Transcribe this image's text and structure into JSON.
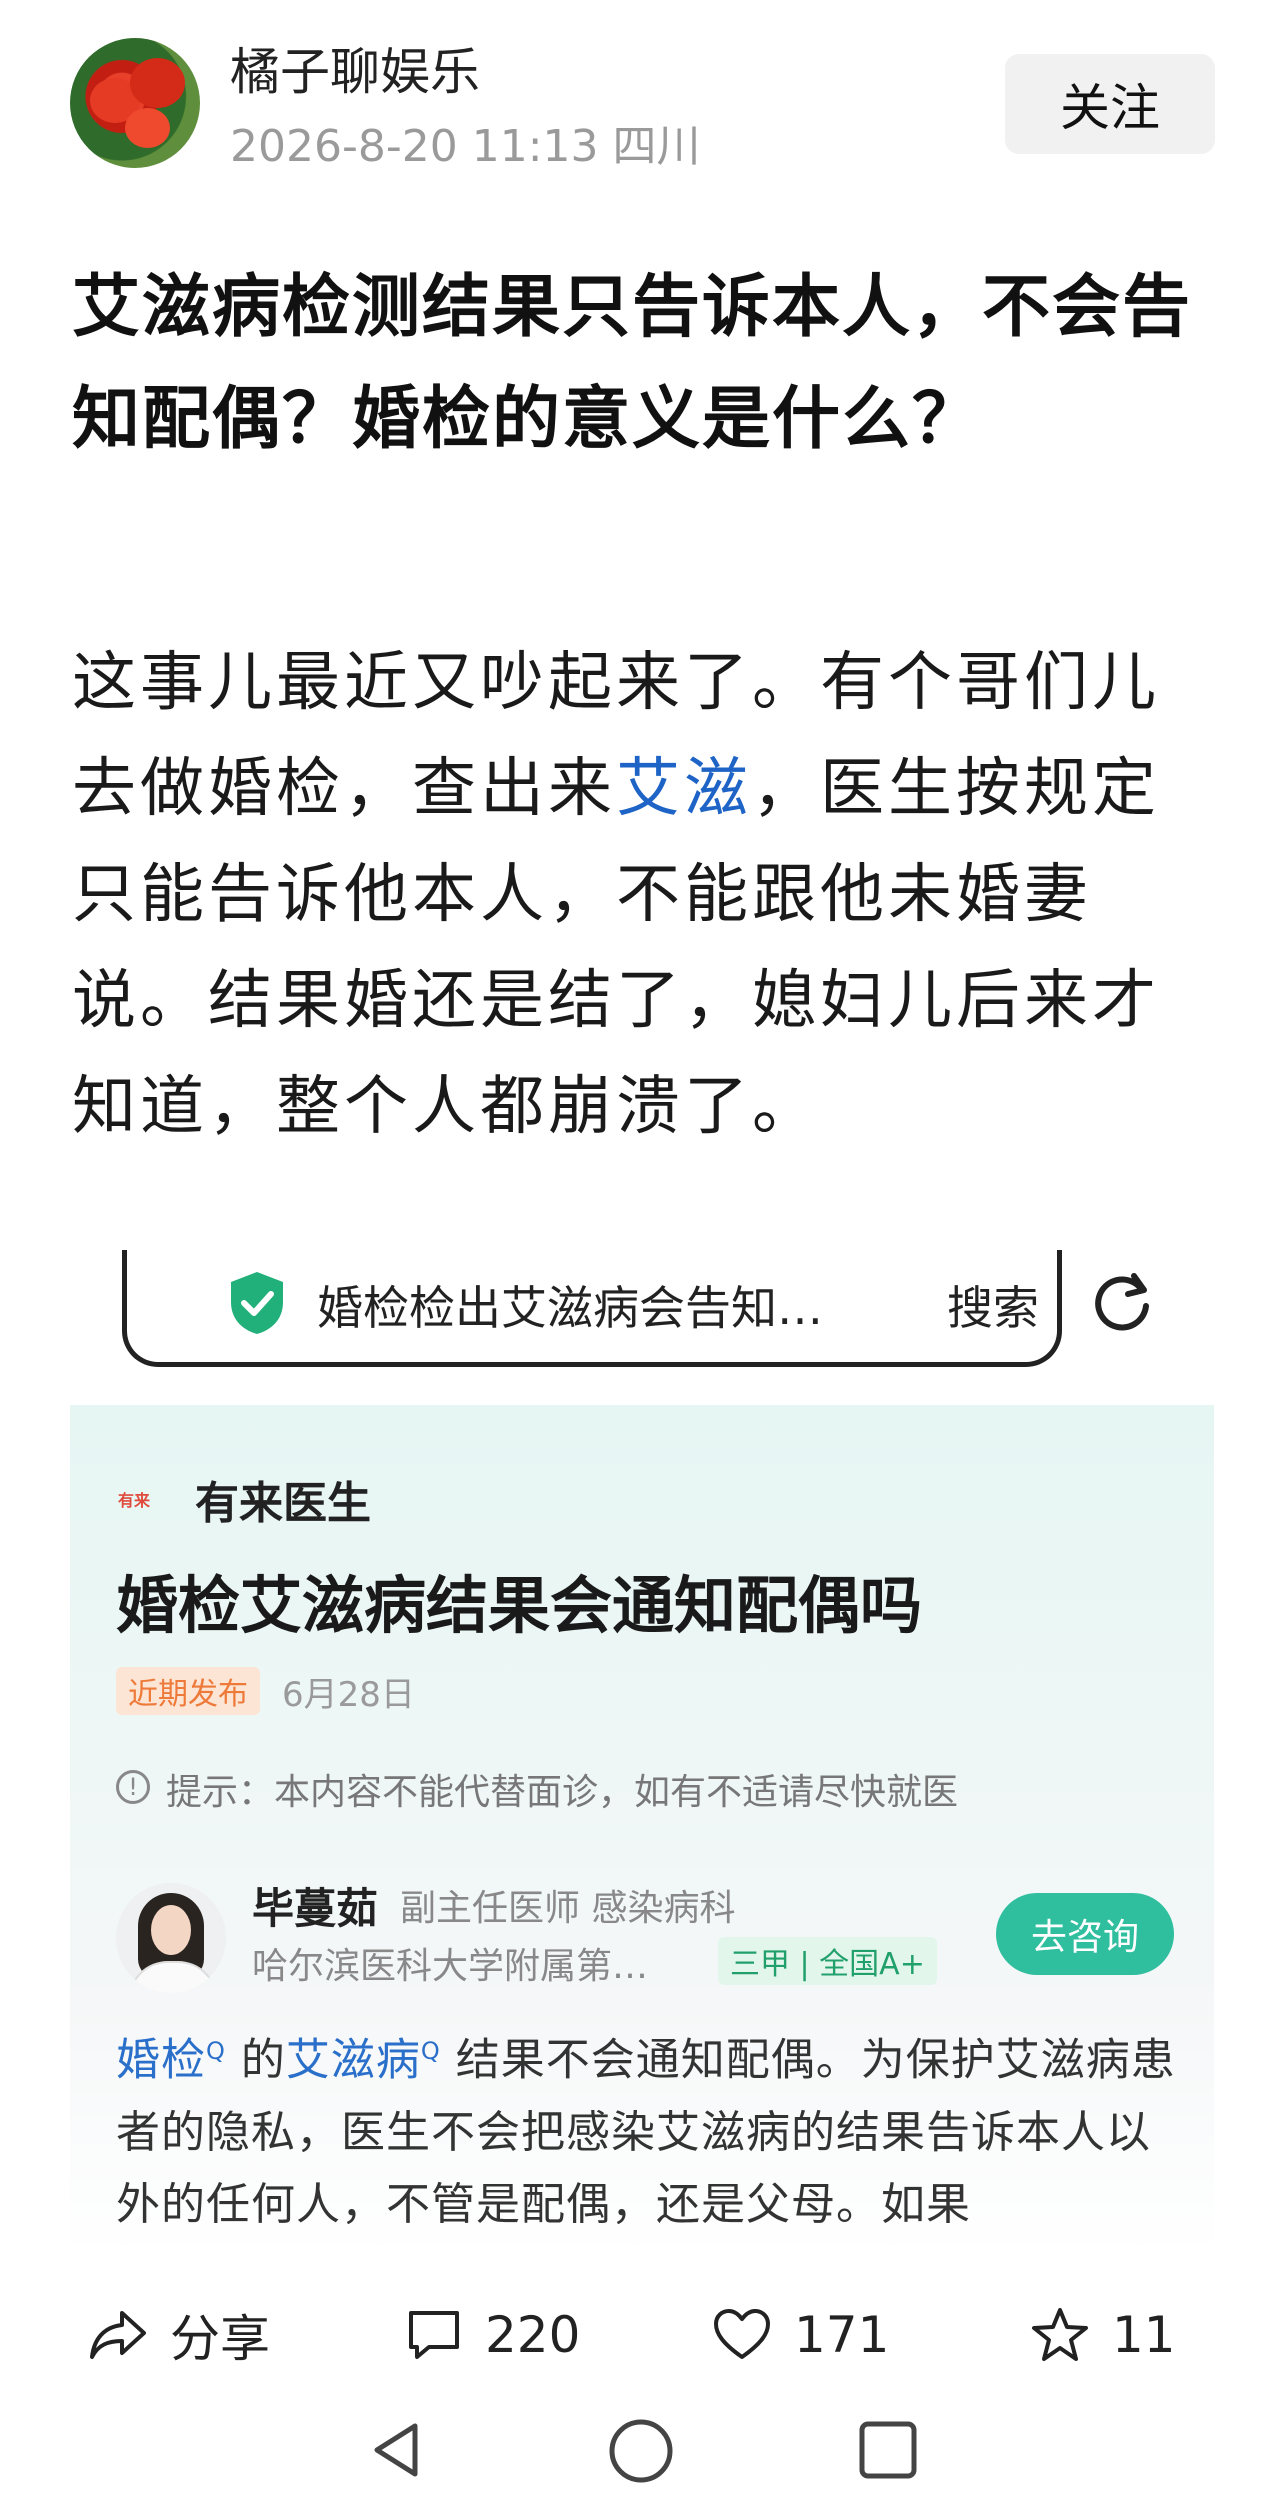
{
  "header": {
    "author": "橘子聊娱乐",
    "meta": "2026-8-20  11:13  四川",
    "follow_label": "关注"
  },
  "article": {
    "title": "艾滋病检测结果只告诉本人，不会告知配偶？婚检的意义是什么？",
    "body_before": "这事儿最近又吵起来了。有个哥们儿去做婚检，查出来",
    "body_link": "艾滋",
    "body_after": "，医生按规定只能告诉他本人，不能跟他未婚妻说。结果婚还是结了，媳妇儿后来才知道，整个人都崩溃了。"
  },
  "screenshot": {
    "search_query": "婚检检出艾滋病会告知…",
    "search_button": "搜索",
    "brand_logo": "有来",
    "brand": "有来医生",
    "title": "婚检艾滋病结果会通知配偶吗",
    "badge": "近期发布",
    "date": "6月28日",
    "tip": "提示：本内容不能代替面诊，如有不适请尽快就医",
    "doctor_name": "毕蔓茹",
    "doctor_title": "副主任医师  感染病科",
    "hospital": "哈尔滨医科大学附属第…",
    "hospital_badge": "三甲 | 全国A+",
    "consult_label": "去咨询",
    "kw1": "婚检",
    "kw2": "艾滋病",
    "answer_rest": "结果不会通知配偶。为保护艾滋病患者的隐私，医生不会把感染艾滋病的结果告诉本人以外的任何人，不管是配偶，还是父母。如果"
  },
  "actions": {
    "share_label": "分享",
    "comments": "220",
    "likes": "171",
    "favorites": "11"
  },
  "colors": {
    "link": "#1e63c6",
    "accent_green": "#2fbf9f"
  }
}
